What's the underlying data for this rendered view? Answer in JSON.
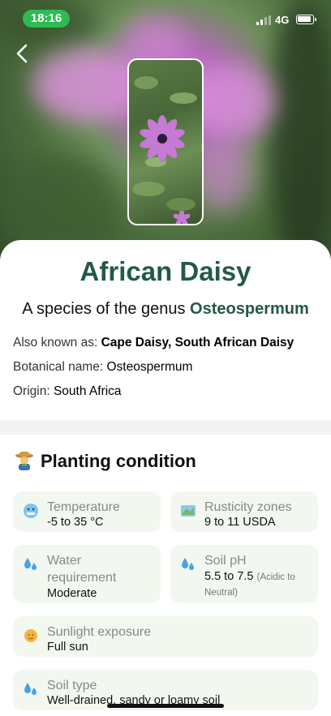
{
  "status_bar": {
    "time": "18:16",
    "network": "4G"
  },
  "plant": {
    "name": "African Daisy",
    "subtitle_prefix": "A species of the genus",
    "genus": "Osteospermum",
    "aka_label": "Also known as:",
    "aka_value": "Cape Daisy, South African Daisy",
    "botanical_label": "Botanical name:",
    "botanical_value": "Osteospermum",
    "origin_label": "Origin:",
    "origin_value": "South Africa"
  },
  "planting": {
    "title": "Planting condition",
    "temperature": {
      "label": "Temperature",
      "value": "-5 to 35 °C",
      "icon": "cold-face-icon"
    },
    "rusticity": {
      "label": "Rusticity zones",
      "value": "9 to 11 USDA",
      "icon": "map-icon"
    },
    "water": {
      "label": "Water requirement",
      "value": "Moderate",
      "icon": "water-drops-icon"
    },
    "soil_ph": {
      "label": "Soil pH",
      "value": "5.5 to 7.5",
      "note": "(Acidic to Neutral)",
      "icon": "water-drops-icon"
    },
    "sunlight": {
      "label": "Sunlight exposure",
      "value": "Full sun",
      "icon": "sun-icon"
    },
    "soil_type": {
      "label": "Soil type",
      "value": "Well-drained, sandy or loamy soil",
      "icon": "water-drops-icon"
    }
  },
  "colors": {
    "accent": "#225a44",
    "tile_bg": "#f2f8ef",
    "status_pill": "#2dbb53",
    "flower": "#c77fcf"
  }
}
